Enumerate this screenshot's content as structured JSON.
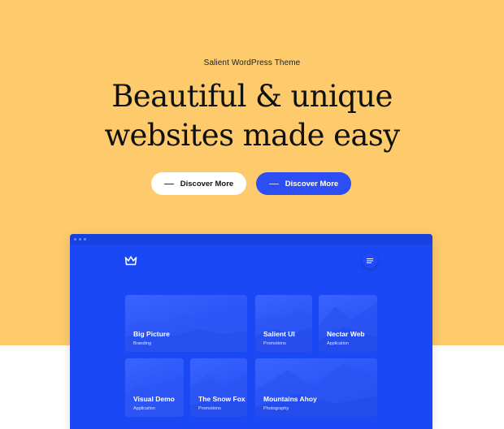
{
  "hero": {
    "eyebrow": "Salient WordPress Theme",
    "headline_line1": "Beautiful & unique",
    "headline_line2": "websites made easy",
    "primary_button": "Discover More",
    "secondary_button": "Discover More",
    "background_color": "#fdca6c"
  },
  "preview": {
    "accent_color": "#1a48f5",
    "logo_icon": "crown-icon",
    "menu_icon": "hamburger-menu-icon",
    "cards": [
      {
        "title": "Big Picture",
        "category": "Branding"
      },
      {
        "title": "Salient UI",
        "category": "Promotions"
      },
      {
        "title": "Nectar Web",
        "category": "Application"
      },
      {
        "title": "Visual Demo",
        "category": "Application"
      },
      {
        "title": "The Snow Fox",
        "category": "Promotions"
      },
      {
        "title": "Mountains Ahoy",
        "category": "Photography"
      }
    ]
  }
}
